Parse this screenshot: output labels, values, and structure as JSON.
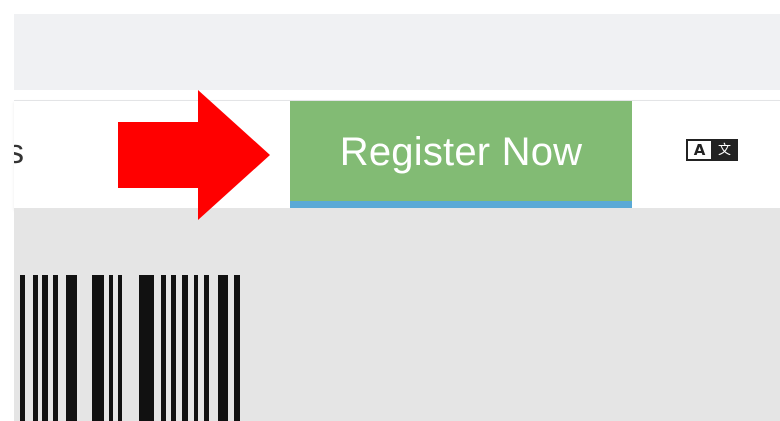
{
  "nav": {
    "cutoff_text": "s",
    "register_button": {
      "label": "Register Now",
      "background": "#82bb74",
      "underline_color": "#5aa9d6"
    },
    "translate_icon": {
      "name": "translate-icon",
      "left_glyph": "A",
      "right_glyph": "文"
    }
  },
  "annotation": {
    "arrow_color": "#ff0000",
    "icon": "arrow-right-icon"
  },
  "content": {
    "background": "#e5e5e5",
    "barcode_icon": "barcode-icon"
  }
}
